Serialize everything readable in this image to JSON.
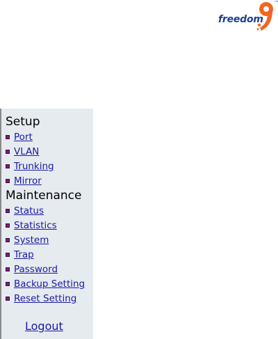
{
  "logo": {
    "word": "freedom",
    "number": "9",
    "trademark": "™",
    "accent": "#f26522",
    "navy": "#1f3f8a"
  },
  "sidebar": {
    "setup_heading": "Setup",
    "setup_items": [
      {
        "label": "Port"
      },
      {
        "label": "VLAN"
      },
      {
        "label": "Trunking"
      },
      {
        "label": "Mirror"
      }
    ],
    "maintenance_heading": "Maintenance",
    "maintenance_items": [
      {
        "label": "Status"
      },
      {
        "label": "Statistics"
      },
      {
        "label": "System"
      },
      {
        "label": "Trap"
      },
      {
        "label": "Password"
      },
      {
        "label": "Backup Setting"
      },
      {
        "label": "Reset Setting"
      }
    ],
    "logout_label": "Logout"
  },
  "colors": {
    "sidebar_bg": "#e6ebef",
    "link": "#1a1aa6",
    "bullet": "#7a1f7a"
  }
}
